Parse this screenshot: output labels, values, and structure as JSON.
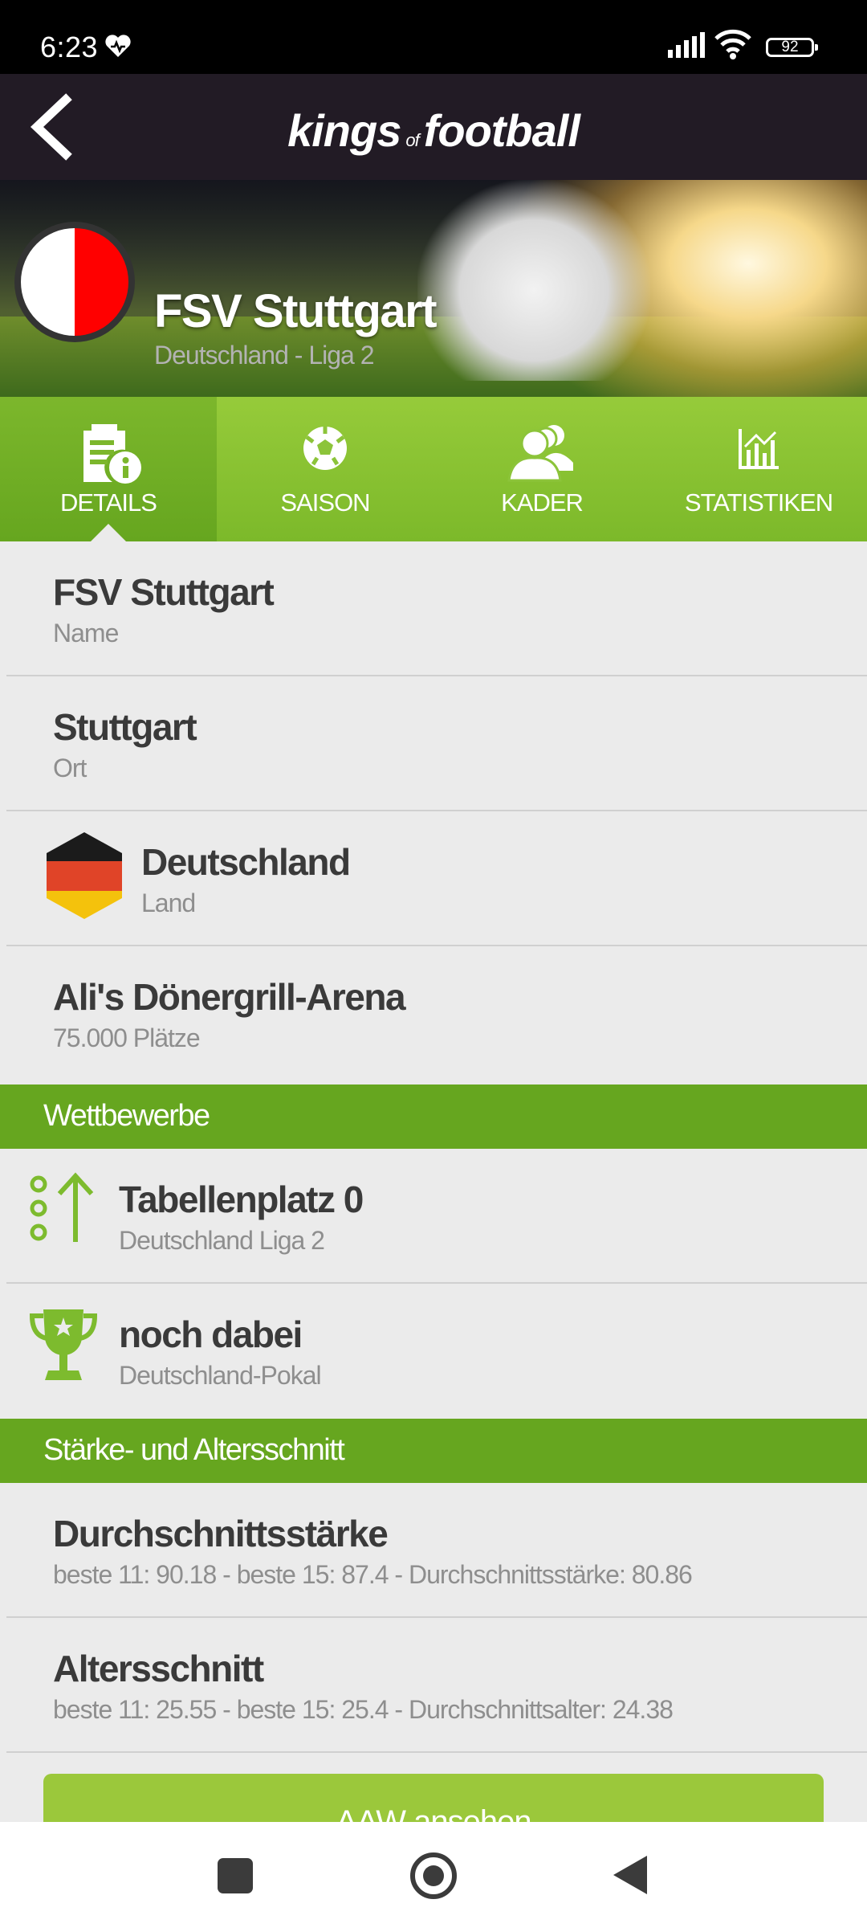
{
  "status_bar": {
    "time": "6:23",
    "battery": "92"
  },
  "app_bar": {
    "logo_main": "kings",
    "logo_of": "of",
    "logo_end": "football"
  },
  "header": {
    "team_name": "FSV Stuttgart",
    "league": "Deutschland - Liga 2"
  },
  "tabs": [
    {
      "label": "DETAILS",
      "icon": "details-icon"
    },
    {
      "label": "SAISON",
      "icon": "soccer-ball-icon"
    },
    {
      "label": "KADER",
      "icon": "team-icon"
    },
    {
      "label": "STATISTIKEN",
      "icon": "stats-chart-icon"
    }
  ],
  "details": [
    {
      "title": "FSV Stuttgart",
      "sub": "Name"
    },
    {
      "title": "Stuttgart",
      "sub": "Ort"
    },
    {
      "title": "Deutschland",
      "sub": "Land",
      "icon": "german-flag-icon"
    },
    {
      "title": "Ali's Dönergrill-Arena",
      "sub": "75.000 Plätze"
    }
  ],
  "sections": {
    "competitions": "Wettbewerbe",
    "strength_age": "Stärke- und Altersschnitt"
  },
  "competitions": [
    {
      "title": "Tabellenplatz 0",
      "sub": "Deutschland Liga 2",
      "icon": "rank-up-icon"
    },
    {
      "title": "noch dabei",
      "sub": "Deutschland-Pokal",
      "icon": "trophy-icon"
    }
  ],
  "strength": [
    {
      "title": "Durchschnittsstärke",
      "sub": "beste 11: 90.18 - beste 15: 87.4 - Durchschnittsstärke: 80.86"
    },
    {
      "title": "Altersschnitt",
      "sub": "beste 11: 25.55 - beste 15: 25.4 - Durchschnittsalter: 24.38"
    }
  ],
  "cta_label": "AAW ansehen",
  "colors": {
    "accent_green": "#66a61f",
    "tab_green": "#8cc43a",
    "appbar": "#221b25",
    "crest_red": "#ff0000"
  }
}
